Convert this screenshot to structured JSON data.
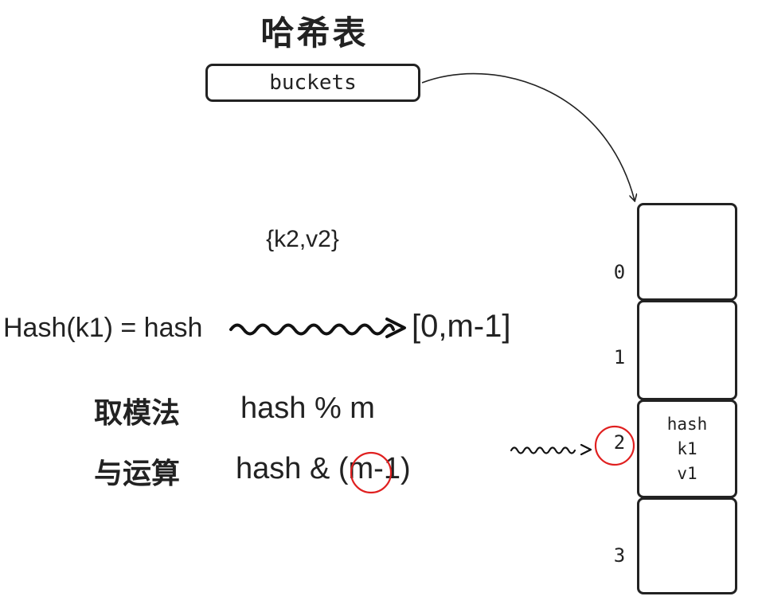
{
  "title": "哈希表",
  "buckets_label": "buckets",
  "pair": "{k2,v2}",
  "hash_expression": "Hash(k1) = hash",
  "range": "[0,m-1]",
  "methods": [
    {
      "label": "取模法",
      "expression": "hash % m"
    },
    {
      "label": "与运算",
      "expression": "hash & (m-1)"
    }
  ],
  "bucket_array": [
    {
      "index": "0",
      "lines": []
    },
    {
      "index": "1",
      "lines": []
    },
    {
      "index": "2",
      "lines": [
        "hash",
        "k1",
        "v1"
      ]
    },
    {
      "index": "3",
      "lines": []
    }
  ],
  "colors": {
    "ink": "#222222",
    "highlight": "#e02020"
  }
}
